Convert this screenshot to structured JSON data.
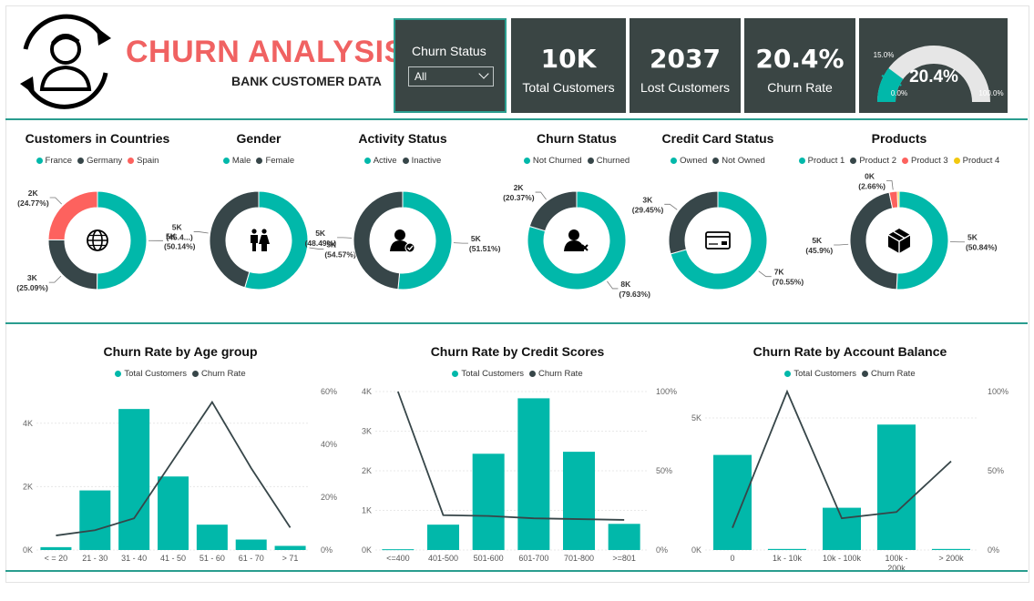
{
  "colors": {
    "teal": "#01b8aa",
    "dark": "#374649",
    "red": "#fd625e",
    "yellow": "#f2c80f",
    "card": "#3a4544",
    "accent": "#2a9d8f"
  },
  "header": {
    "title": "CHURN ANALYSIS",
    "subtitle": "BANK CUSTOMER DATA",
    "logo_icon": "user-refresh-icon"
  },
  "slicer": {
    "title": "Churn Status",
    "selected": "All"
  },
  "kpis": [
    {
      "value": "10K",
      "label": "Total Customers"
    },
    {
      "value": "2037",
      "label": "Lost Customers"
    },
    {
      "value": "20.4%",
      "label": "Churn Rate"
    }
  ],
  "gauge": {
    "value_label": "20.4%",
    "min_label": "0.0%",
    "max_label": "100.0%",
    "target_label": "15.0%",
    "value": 0.204,
    "target": 0.15
  },
  "donuts": [
    {
      "title": "Customers in Countries",
      "icon": "globe-icon",
      "legend": [
        {
          "name": "France",
          "color": "#01b8aa"
        },
        {
          "name": "Germany",
          "color": "#374649"
        },
        {
          "name": "Spain",
          "color": "#fd625e"
        }
      ],
      "slices": [
        {
          "value": 50.14,
          "color": "#01b8aa"
        },
        {
          "value": 25.09,
          "color": "#374649"
        },
        {
          "value": 24.77,
          "color": "#fd625e"
        }
      ],
      "labels": [
        {
          "count": "5K",
          "pct": "(50.14%)"
        },
        {
          "count": "3K",
          "pct": "(25.09%)"
        },
        {
          "count": "2K",
          "pct": "(24.77%)"
        }
      ]
    },
    {
      "title": "Gender",
      "icon": "family-icon",
      "legend": [
        {
          "name": "Male",
          "color": "#01b8aa"
        },
        {
          "name": "Female",
          "color": "#374649"
        }
      ],
      "slices": [
        {
          "value": 54.57,
          "color": "#01b8aa"
        },
        {
          "value": 45.43,
          "color": "#374649"
        }
      ],
      "labels": [
        {
          "count": "5K",
          "pct": "(54.57%)"
        },
        {
          "count": "5K",
          "pct": "(45.4...)"
        }
      ]
    },
    {
      "title": "Activity Status",
      "icon": "user-check-icon",
      "legend": [
        {
          "name": "Active",
          "color": "#01b8aa"
        },
        {
          "name": "Inactive",
          "color": "#374649"
        }
      ],
      "slices": [
        {
          "value": 51.51,
          "color": "#01b8aa"
        },
        {
          "value": 48.49,
          "color": "#374649"
        }
      ],
      "labels": [
        {
          "count": "5K",
          "pct": "(51.51%)"
        },
        {
          "count": "5K",
          "pct": "(48.49%)"
        }
      ]
    },
    {
      "title": "Churn Status",
      "icon": "user-remove-icon",
      "legend": [
        {
          "name": "Not Churned",
          "color": "#01b8aa"
        },
        {
          "name": "Churned",
          "color": "#374649"
        }
      ],
      "slices": [
        {
          "value": 79.63,
          "color": "#01b8aa"
        },
        {
          "value": 20.37,
          "color": "#374649"
        }
      ],
      "labels": [
        {
          "count": "8K",
          "pct": "(79.63%)"
        },
        {
          "count": "2K",
          "pct": "(20.37%)"
        }
      ]
    },
    {
      "title": "Credit Card Status",
      "icon": "credit-card-icon",
      "legend": [
        {
          "name": "Owned",
          "color": "#01b8aa"
        },
        {
          "name": "Not Owned",
          "color": "#374649"
        }
      ],
      "slices": [
        {
          "value": 70.55,
          "color": "#01b8aa"
        },
        {
          "value": 29.45,
          "color": "#374649"
        }
      ],
      "labels": [
        {
          "count": "7K",
          "pct": "(70.55%)"
        },
        {
          "count": "3K",
          "pct": "(29.45%)"
        }
      ]
    },
    {
      "title": "Products",
      "icon": "package-icon",
      "legend": [
        {
          "name": "Product 1",
          "color": "#01b8aa"
        },
        {
          "name": "Product 2",
          "color": "#374649"
        },
        {
          "name": "Product 3",
          "color": "#fd625e"
        },
        {
          "name": "Product 4",
          "color": "#f2c80f"
        }
      ],
      "slices": [
        {
          "value": 50.84,
          "color": "#01b8aa"
        },
        {
          "value": 45.9,
          "color": "#374649"
        },
        {
          "value": 2.66,
          "color": "#fd625e"
        },
        {
          "value": 0.6,
          "color": "#f2c80f"
        }
      ],
      "labels": [
        {
          "count": "5K",
          "pct": "(50.84%)"
        },
        {
          "count": "5K",
          "pct": "(45.9%)"
        },
        {
          "count": "0K",
          "pct": "(2.66%)"
        }
      ]
    }
  ],
  "chart_data": [
    {
      "type": "bar",
      "title": "Churn Rate by Age group",
      "legend": [
        "Total Customers",
        "Churn Rate"
      ],
      "categories": [
        "< = 20",
        "21 - 30",
        "31 - 40",
        "41 - 50",
        "51 - 60",
        "61 - 70",
        "> 71"
      ],
      "series": [
        {
          "name": "Total Customers",
          "type": "bar",
          "values": [
            90,
            1880,
            4450,
            2320,
            800,
            330,
            130
          ],
          "axis": "left"
        },
        {
          "name": "Churn Rate",
          "type": "line",
          "values": [
            5.5,
            7.5,
            12.0,
            34.0,
            56.0,
            31.0,
            8.5
          ],
          "axis": "right"
        }
      ],
      "left_ticks": [
        "0K",
        "2K",
        "4K"
      ],
      "left_max": 5000,
      "right_ticks": [
        "0%",
        "20%",
        "40%",
        "60%"
      ],
      "right_max": 60
    },
    {
      "type": "bar",
      "title": "Churn Rate by Credit Scores",
      "legend": [
        "Total Customers",
        "Churn Rate"
      ],
      "categories": [
        "<=400",
        "401-500",
        "501-600",
        "601-700",
        "701-800",
        ">=801"
      ],
      "series": [
        {
          "name": "Total Customers",
          "type": "bar",
          "values": [
            20,
            640,
            2430,
            3830,
            2480,
            660
          ],
          "axis": "left"
        },
        {
          "name": "Churn Rate",
          "type": "line",
          "values": [
            100,
            22,
            21.5,
            20,
            19.5,
            19
          ],
          "axis": "right"
        }
      ],
      "left_ticks": [
        "0K",
        "1K",
        "2K",
        "3K",
        "4K"
      ],
      "left_max": 4000,
      "right_ticks": [
        "0%",
        "50%",
        "100%"
      ],
      "right_max": 100
    },
    {
      "type": "bar",
      "title": "Churn Rate by Account Balance",
      "legend": [
        "Total Customers",
        "Churn Rate"
      ],
      "categories": [
        "0",
        "1k - 10k",
        "10k - 100k",
        "100k - 200k",
        "> 200k"
      ],
      "series": [
        {
          "name": "Total Customers",
          "type": "bar",
          "values": [
            3600,
            40,
            1600,
            4750,
            40
          ],
          "axis": "left"
        },
        {
          "name": "Churn Rate",
          "type": "line",
          "values": [
            14,
            100,
            20,
            24,
            56
          ],
          "axis": "right"
        }
      ],
      "left_ticks": [
        "0K",
        "5K"
      ],
      "left_max": 6000,
      "right_ticks": [
        "0%",
        "50%",
        "100%"
      ],
      "right_max": 100
    }
  ]
}
